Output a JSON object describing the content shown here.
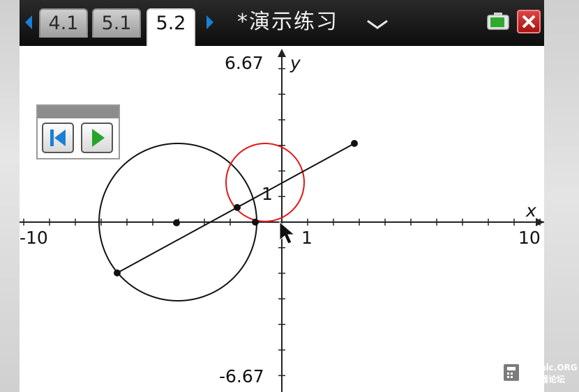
{
  "tabs": [
    {
      "label": "4.1",
      "active": false
    },
    {
      "label": "5.1",
      "active": false
    },
    {
      "label": "5.2",
      "active": true
    }
  ],
  "document_title": "*演示练习",
  "icons": {
    "tab_prev": "left-arrow-icon",
    "tab_next": "right-arrow-icon",
    "title_menu": "chevron-down-icon",
    "battery": "battery-icon",
    "close": "close-icon",
    "player_back": "skip-back-icon",
    "player_play": "play-icon",
    "cursor": "mouse-pointer-icon",
    "watermark": "calculator-icon"
  },
  "colors": {
    "accent_blue": "#1a7fd6",
    "play_green": "#27a52a",
    "close_red": "#c0262b",
    "small_circle": "#e01818",
    "big_circle": "#111111"
  },
  "graph": {
    "x_axis_label": "x",
    "y_axis_label": "y",
    "x_min_label": "-10",
    "x_max_label": "10",
    "y_max_label": "6.67",
    "y_min_label": "-6.67",
    "x_tick_label": "1",
    "point_label": "1",
    "x_range": [
      -10,
      10
    ],
    "y_range": [
      -6.67,
      6.67
    ]
  },
  "watermark": {
    "line1": "cnCalc.ORG",
    "line2": "计算器论坛"
  }
}
